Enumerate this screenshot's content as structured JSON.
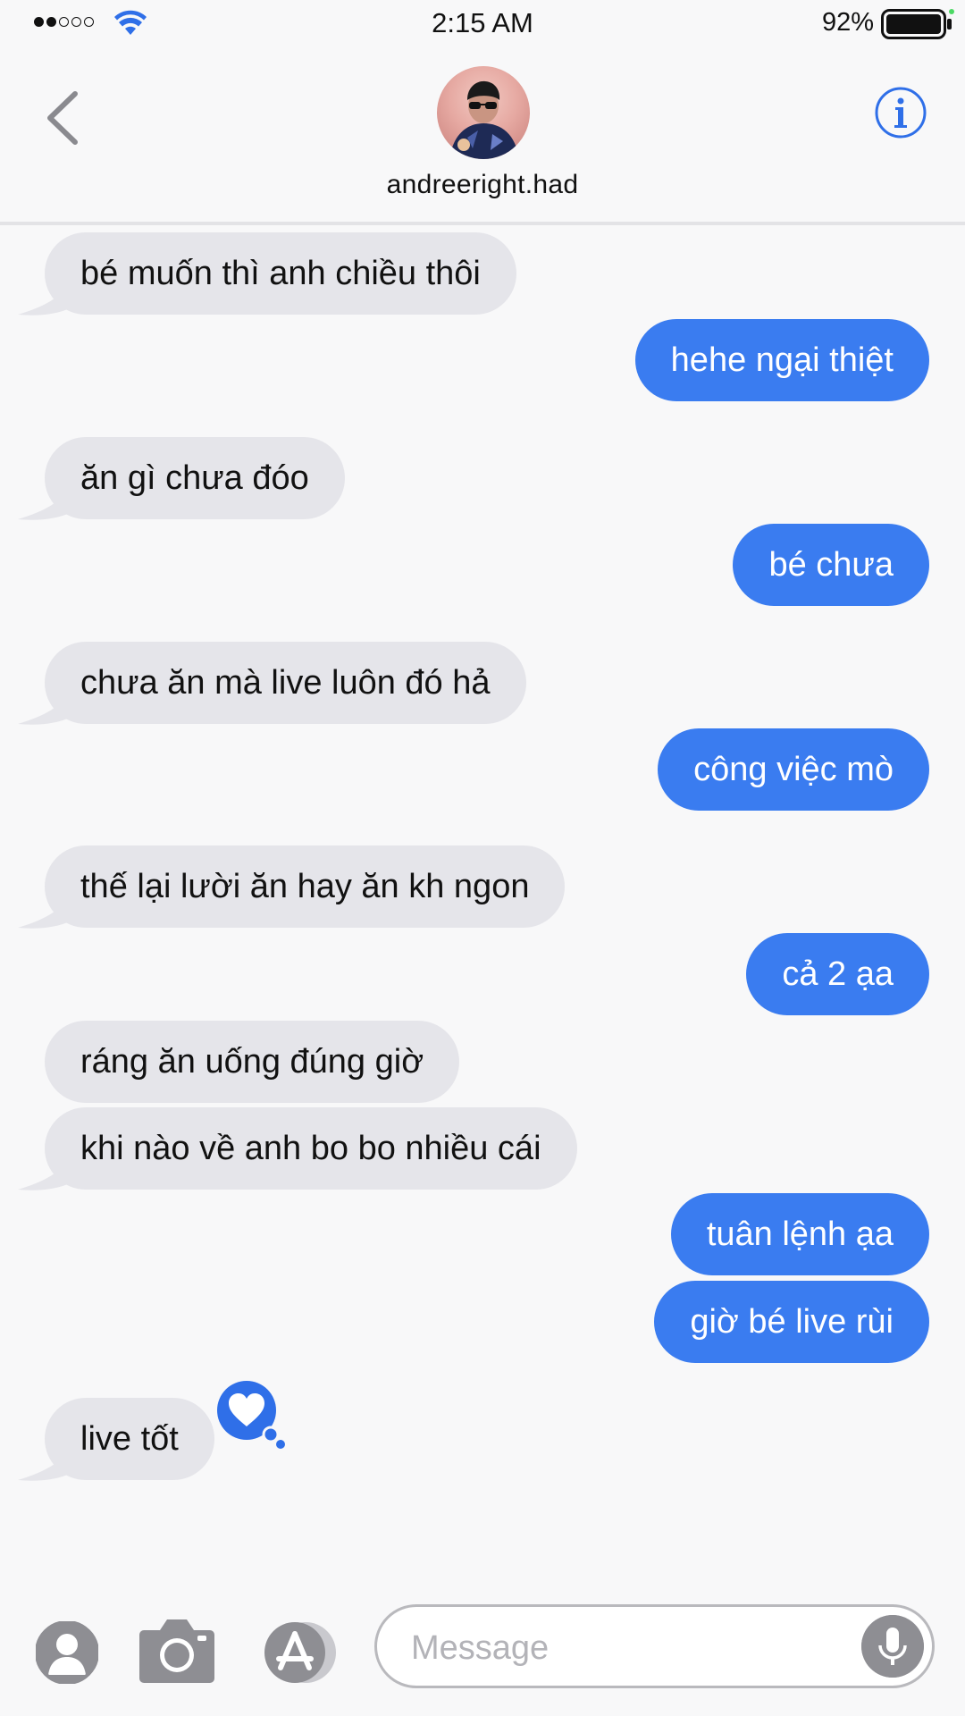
{
  "status_bar": {
    "time": "2:15 AM",
    "battery_percent": "92%",
    "signal_strength": 2,
    "signal_max": 5
  },
  "header": {
    "contact_name": "andreeright.had",
    "back_icon": "chevron-left-icon",
    "info_icon": "info-icon"
  },
  "colors": {
    "accent": "#3a7cf0",
    "incoming_bubble": "#e5e5ea",
    "background": "#f8f8f9"
  },
  "messages": [
    {
      "direction": "in",
      "text": "bé muốn thì anh chiều thôi"
    },
    {
      "direction": "out",
      "text": "hehe ngại thiệt"
    },
    {
      "direction": "in",
      "text": "ăn gì chưa đóo"
    },
    {
      "direction": "out",
      "text": "bé chưa"
    },
    {
      "direction": "in",
      "text": "chưa ăn mà live luôn đó hả"
    },
    {
      "direction": "out",
      "text": "công việc mò"
    },
    {
      "direction": "in",
      "text": "thế lại lười ăn hay ăn kh ngon"
    },
    {
      "direction": "out",
      "text": "cả 2 ạa"
    },
    {
      "direction": "in",
      "text": "ráng ăn uống đúng giờ"
    },
    {
      "direction": "in",
      "text": "khi nào về anh bo bo nhiều cái"
    },
    {
      "direction": "out",
      "text": "tuân lệnh ạa"
    },
    {
      "direction": "out",
      "text": "giờ bé live rùi"
    },
    {
      "direction": "in",
      "text": "live tốt",
      "reaction": "heart-icon"
    }
  ],
  "input_bar": {
    "placeholder": "Message",
    "value": "",
    "buttons": [
      "contacts-icon",
      "camera-icon",
      "app-store-icon",
      "microphone-icon"
    ]
  }
}
